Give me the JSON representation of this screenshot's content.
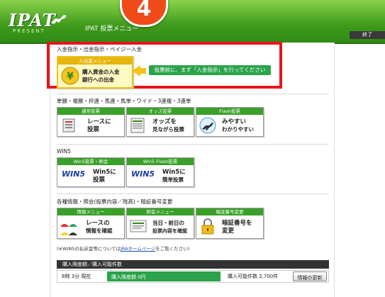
{
  "header": {
    "logo": "IPAT",
    "logo_sub": "PRESENT",
    "nav_title": "IPAT  投票メニュー",
    "step_number": "4",
    "logout": "終了"
  },
  "deposit_section": {
    "title": "入金指示・出金指示・ペイジー入金",
    "button_caption": "入出金メニュー",
    "button_line1": "購入資金の入金",
    "button_line2": "銀行への出金",
    "callout": "投票前に、まず「入金指示」を行ってください"
  },
  "bet_section": {
    "title": "単勝・複勝・枠連・馬連・馬単・ワイド・3連複・3連単",
    "buttons": [
      {
        "caption": "通常投票",
        "line1": "レースに",
        "line2": "投票"
      },
      {
        "caption": "オッズ投票",
        "line1": "オッズを",
        "line2": "見ながら投票"
      },
      {
        "caption": "Flash投票",
        "line1": "みやすい",
        "line2": "わかりやすい"
      }
    ]
  },
  "win5_section": {
    "title": "WIN5",
    "buttons": [
      {
        "caption": "Win5投票・照会",
        "line1": "Win5に",
        "line2": "投票",
        "logo": "WIN5"
      },
      {
        "caption": "Win5 Flash投票",
        "line1": "Win5に",
        "line2": "簡単投票",
        "logo": "WIN5"
      }
    ]
  },
  "info_section": {
    "title": "各種情報・照会(投票内容／残高)・暗証番号変更",
    "buttons": [
      {
        "caption": "情報メニュー",
        "line1": "レースの",
        "line2": "情報を確認"
      },
      {
        "caption": "照会メニュー",
        "line1": "当日・前日の",
        "line2": "投票内容を確認"
      },
      {
        "caption": "暗証番号変更",
        "line1": "暗証番号を",
        "line2": "変更"
      }
    ]
  },
  "note": {
    "prefix": "(※WIN5の払戻金等については",
    "link": "JRAホームページ",
    "suffix": "をご覧ください)"
  },
  "limit": {
    "bar_title": "購入限度額／購入可能件数",
    "time": "8時 3分  現在",
    "limit_label": "購入限度額  0円",
    "count_label": "購入可能件数  2,700件",
    "refresh": "情報の更新"
  },
  "colors": {
    "header_green": "#3e9a1c",
    "accent_red": "#e8141c",
    "step_orange": "#f04a18",
    "caption_green": "#3ba02a",
    "callout_green": "#2aa34a",
    "yen_yellow": "#e6b510"
  }
}
